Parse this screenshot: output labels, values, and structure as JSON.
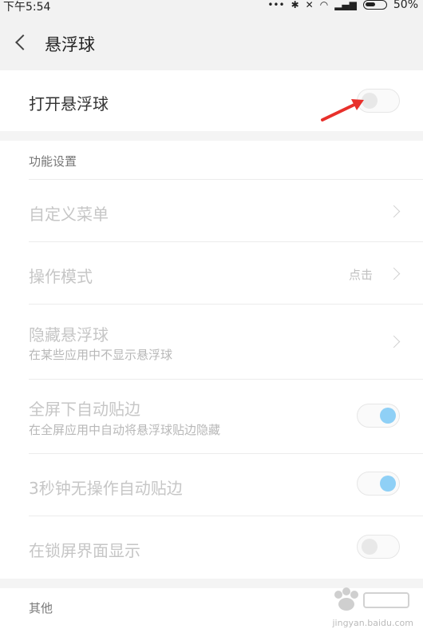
{
  "status_bar": {
    "time": "下午5:54",
    "battery": "50%"
  },
  "header": {
    "title": "悬浮球"
  },
  "main_toggle": {
    "label": "打开悬浮球",
    "enabled": false
  },
  "section_function": {
    "title": "功能设置",
    "items": [
      {
        "label": "自定义菜单"
      },
      {
        "label": "操作模式",
        "value": "点击"
      },
      {
        "label": "隐藏悬浮球",
        "sublabel": "在某些应用中不显示悬浮球"
      },
      {
        "label": "全屏下自动贴边",
        "sublabel": "在全屏应用中自动将悬浮球贴边隐藏",
        "enabled": true
      },
      {
        "label": "3秒钟无操作自动贴边",
        "enabled": true
      },
      {
        "label": "在锁屏界面显示",
        "enabled": false
      }
    ]
  },
  "section_other": {
    "title": "其他"
  },
  "watermark": {
    "url": "jingyan.baidu.com"
  },
  "colors": {
    "toggle_on": "#8fd0f6",
    "arrow": "#e8302b"
  }
}
